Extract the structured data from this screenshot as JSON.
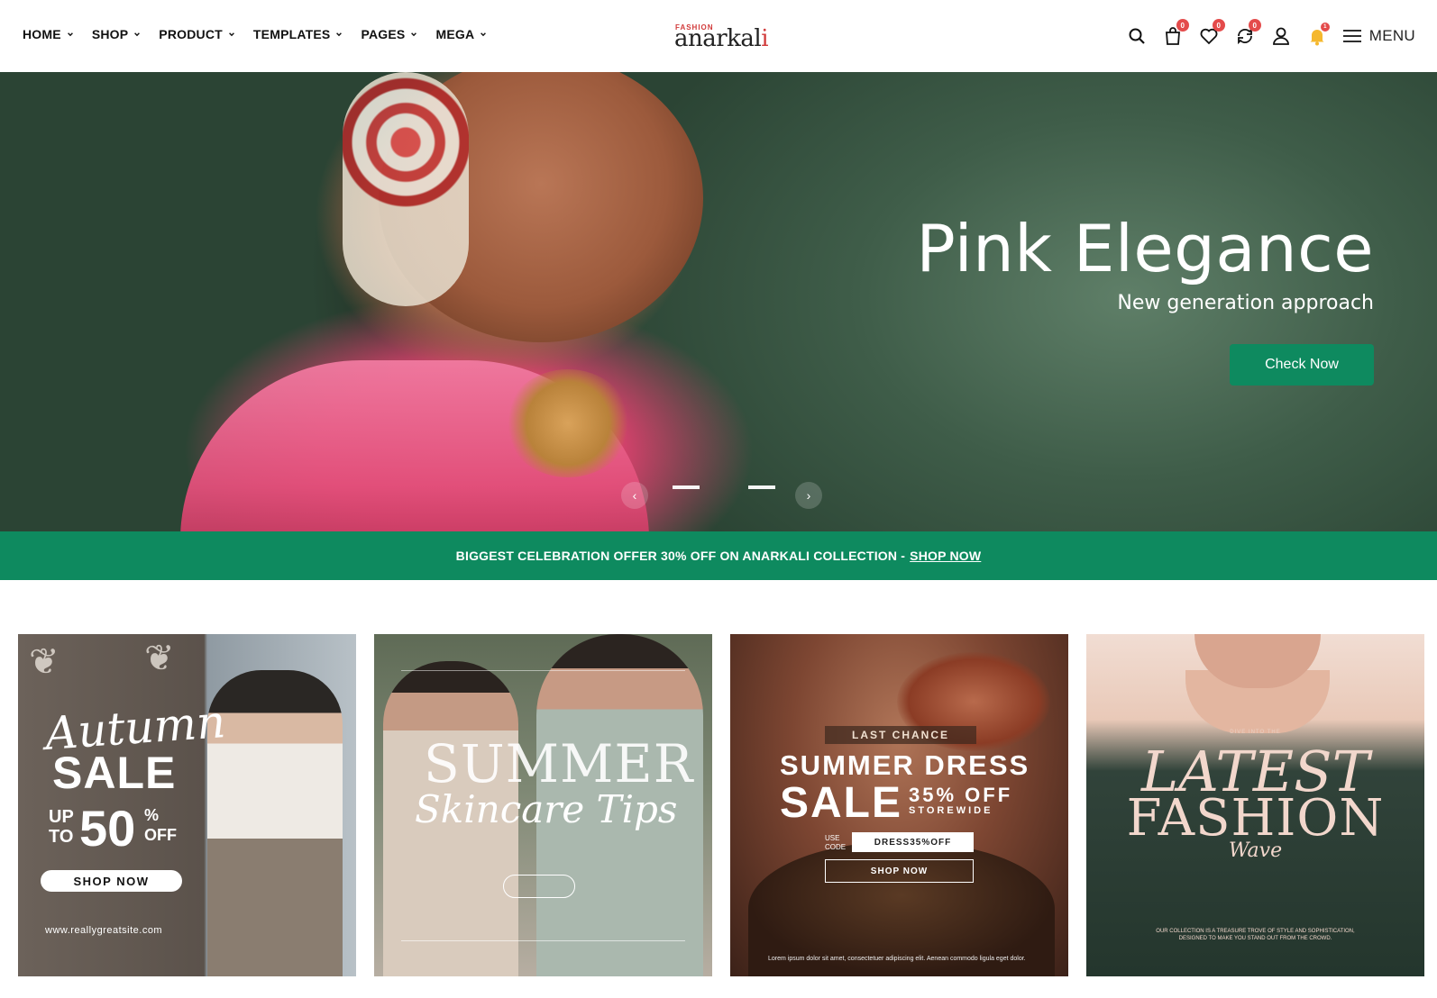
{
  "nav": {
    "items": [
      {
        "label": "HOME"
      },
      {
        "label": "SHOP"
      },
      {
        "label": "PRODUCT"
      },
      {
        "label": "TEMPLATES"
      },
      {
        "label": "PAGES"
      },
      {
        "label": "MEGA"
      }
    ]
  },
  "logo": {
    "tagline": "FASHION",
    "name_part1": "anarkal",
    "name_part2": "i"
  },
  "header_icons": {
    "cart_count": "0",
    "wishlist_count": "0",
    "compare_count": "0",
    "notification_count": "1",
    "menu_label": "MENU"
  },
  "hero": {
    "title": "Pink Elegance",
    "subtitle": "New generation approach",
    "cta": "Check Now",
    "prev_glyph": "‹",
    "next_glyph": "›"
  },
  "offer": {
    "text": "BIGGEST CELEBRATION OFFER 30% OFF ON ANARKALI COLLECTION -",
    "link": "SHOP NOW"
  },
  "cards": {
    "autumn": {
      "script": "Autumn",
      "sale": "SALE",
      "up_to_1": "UP",
      "up_to_2": "TO",
      "percent": "50",
      "pct_sign": "%",
      "off": "OFF",
      "button": "SHOP NOW",
      "url": "www.reallygreatsite.com"
    },
    "summer_tips": {
      "line1": "SUMMER",
      "line2": "Skincare Tips"
    },
    "summer_dress": {
      "badge": "LAST CHANCE",
      "line1": "SUMMER DRESS",
      "line2": "SALE",
      "percent": "35% OFF",
      "storewide": "STOREWIDE",
      "use_code_1": "USE",
      "use_code_2": "CODE",
      "code": "DRESS35%OFF",
      "button": "SHOP NOW",
      "footer": "Lorem ipsum dolor sit amet, consectetuer adipiscing elit. Aenean commodo ligula eget dolor."
    },
    "latest_fashion": {
      "small": "DIVE INTO THE",
      "line1": "LATEST",
      "line2": "FASHION",
      "line3": "Wave",
      "footer": "OUR COLLECTION IS A TREASURE TROVE OF STYLE AND SOPHISTICATION, DESIGNED TO MAKE YOU STAND OUT FROM THE CROWD."
    }
  },
  "colors": {
    "brand_green": "#0e8a5f",
    "badge_red": "#e44b4b",
    "logo_accent": "#d13a3a"
  }
}
